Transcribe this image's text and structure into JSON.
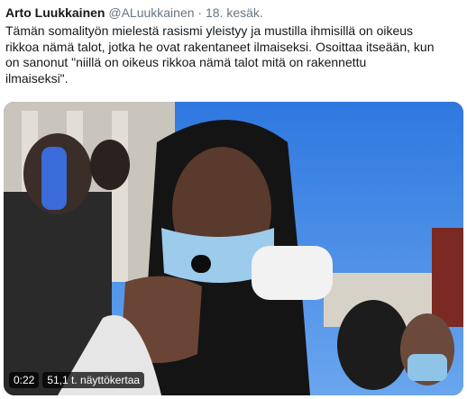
{
  "tweet": {
    "author_name": "Arto Luukkainen",
    "handle": "@ALuukkainen",
    "separator": "·",
    "date": "18. kesäk.",
    "text_lines": [
      "Tämän somalityön mielestä rasismi yleistyy ja mustilla ihmisillä on oikeus",
      "rikkoa nämä talot, jotka he ovat rakentaneet ilmaiseksi. Osoittaa itseään, kun",
      "on sanonut \"niillä on oikeus rikkoa nämä talot mitä on rakennettu",
      "ilmaiseksi\"."
    ]
  },
  "video": {
    "duration": "0:22",
    "views": "51,1 t. näyttökertaa"
  }
}
